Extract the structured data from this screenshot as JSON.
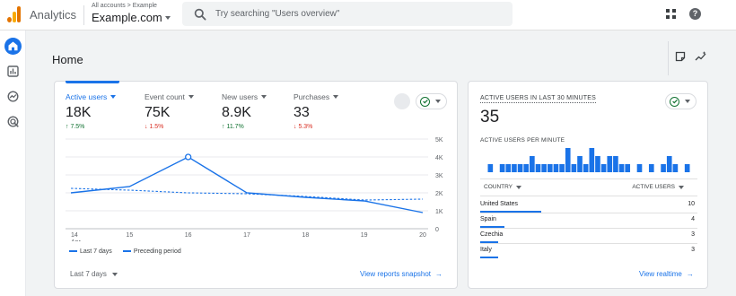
{
  "header": {
    "app_title": "Analytics",
    "breadcrumb": "All accounts > Example",
    "property": "Example.com",
    "search_placeholder": "Try searching \"Users overview\""
  },
  "page": {
    "title": "Home"
  },
  "colors": {
    "accent": "#1a73e8",
    "positive": "#137333",
    "negative": "#d93025"
  },
  "overview": {
    "metrics": [
      {
        "label": "Active users",
        "value": "18K",
        "change": "↑ 7.5%",
        "trend": "up",
        "active": true
      },
      {
        "label": "Event count",
        "value": "75K",
        "change": "↓ 1.5%",
        "trend": "down",
        "active": false
      },
      {
        "label": "New users",
        "value": "8.9K",
        "change": "↑ 11.7%",
        "trend": "up",
        "active": false
      },
      {
        "label": "Purchases",
        "value": "33",
        "change": "↓ 5.3%",
        "trend": "down",
        "active": false
      }
    ],
    "legend": {
      "current": "Last 7 days",
      "previous": "Preceding period"
    },
    "date_range": "Last 7 days",
    "link": "View reports snapshot"
  },
  "chart_data": {
    "type": "line",
    "x": [
      "14",
      "15",
      "16",
      "17",
      "18",
      "19",
      "20"
    ],
    "x_month_label": "Apr",
    "y_ticks": [
      "5K",
      "4K",
      "3K",
      "2K",
      "1K",
      "0"
    ],
    "ylim": [
      0,
      5000
    ],
    "grid": true,
    "series": [
      {
        "name": "Last 7 days",
        "style": "solid",
        "values": [
          2000,
          2350,
          4000,
          2000,
          1750,
          1550,
          900
        ]
      },
      {
        "name": "Preceding period",
        "style": "dashed",
        "values": [
          2250,
          2150,
          2000,
          1950,
          1800,
          1600,
          1650
        ]
      }
    ]
  },
  "realtime": {
    "title": "ACTIVE USERS IN LAST 30 MINUTES",
    "value": "35",
    "per_minute_label": "ACTIVE USERS PER MINUTE",
    "per_minute": [
      1,
      0,
      1,
      1,
      1,
      1,
      1,
      2,
      1,
      1,
      1,
      1,
      1,
      3,
      1,
      2,
      1,
      3,
      2,
      1,
      2,
      2,
      1,
      1,
      0,
      1,
      0,
      1,
      0,
      1,
      2,
      1,
      0,
      1
    ],
    "columns": {
      "country": "COUNTRY",
      "users": "ACTIVE USERS"
    },
    "rows": [
      {
        "country": "United States",
        "users": "10",
        "share": 1.0
      },
      {
        "country": "Spain",
        "users": "4",
        "share": 0.4
      },
      {
        "country": "Czechia",
        "users": "3",
        "share": 0.3
      },
      {
        "country": "Italy",
        "users": "3",
        "share": 0.3
      }
    ],
    "link": "View realtime"
  }
}
